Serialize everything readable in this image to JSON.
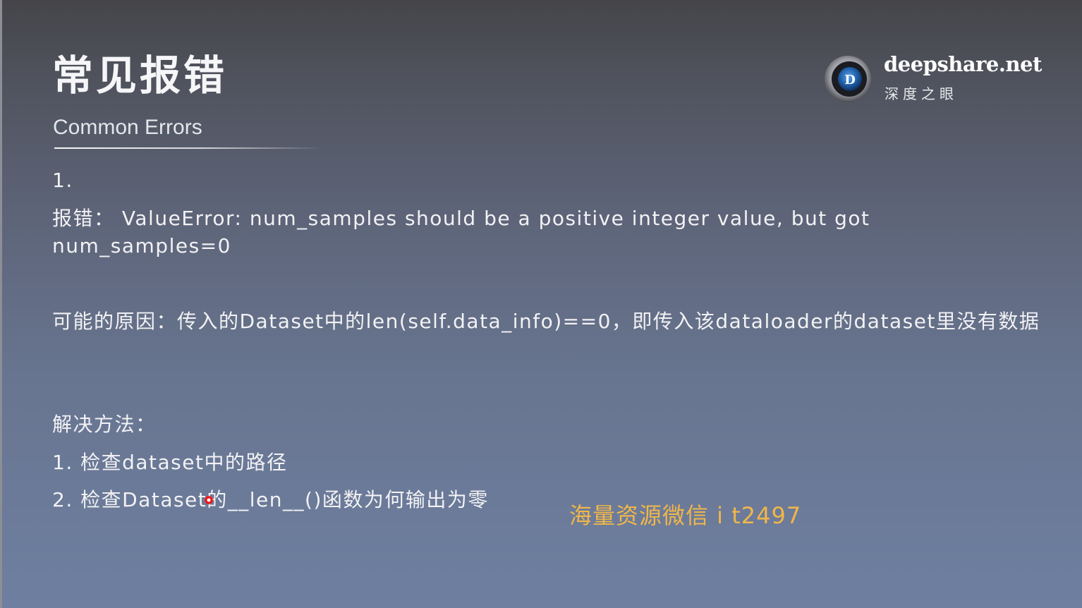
{
  "slide": {
    "title": "常见报错",
    "subtitle": "Common Errors"
  },
  "logo": {
    "name": "deepshare.net",
    "tagline": "深度之眼",
    "mark_letter": "D"
  },
  "content": {
    "item_number": "1.",
    "error_line": "报错： ValueError: num_samples should be a positive integer value, but got num_samples=0",
    "cause_line": "可能的原因：传入的Dataset中的len(self.data_info)==0，即传入该dataloader的dataset里没有数据",
    "solution_heading": "解决方法：",
    "solutions": [
      "1. 检查dataset中的路径",
      "2. 检查Dataset的__len__()函数为何输出为零"
    ]
  },
  "watermark": {
    "text": "海量资源微信 i t2497"
  },
  "colors": {
    "background_top": "#454549",
    "background_bottom": "#6e7fa0",
    "text": "#f2f2f4",
    "watermark": "#f0b64a",
    "logo_blue": "#2a6fb8"
  }
}
